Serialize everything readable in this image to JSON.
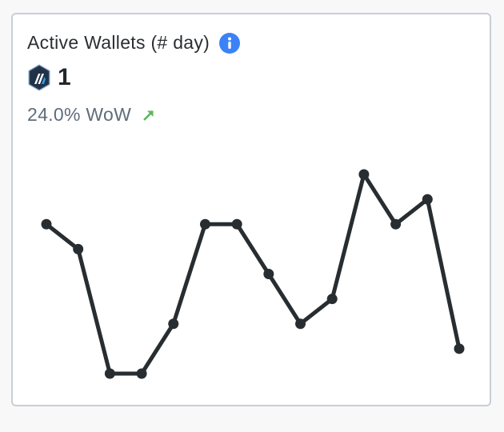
{
  "card": {
    "title": "Active Wallets (# day)",
    "info_icon": "info-icon",
    "logo_icon": "arbitrum-logo-icon",
    "value": "1",
    "change_text": "24.0% WoW",
    "change_icon": "arrow-up-right-icon",
    "change_color": "#5cb85c",
    "accent_color": "#3b82f6"
  },
  "chart_data": {
    "type": "line",
    "x": [
      1,
      2,
      3,
      4,
      5,
      6,
      7,
      8,
      9,
      10,
      11,
      12,
      13,
      14
    ],
    "series": [
      {
        "values": [
          10.0,
          9.5,
          7.0,
          7.0,
          8.0,
          10.0,
          10.0,
          9.0,
          8.0,
          8.5,
          11.0,
          10.0,
          10.5,
          7.5
        ]
      }
    ],
    "line_color": "#272d30",
    "grid": false,
    "axes_visible": false
  }
}
